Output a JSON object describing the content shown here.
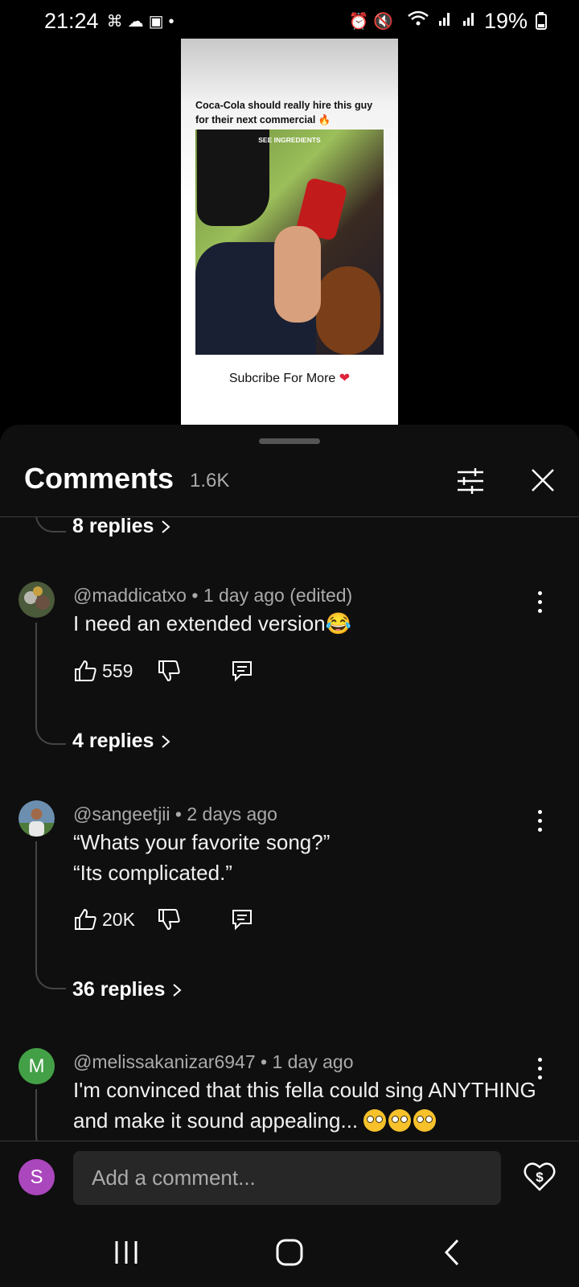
{
  "status_bar": {
    "time": "21:24",
    "left_icons": [
      "game-icon",
      "cloud-icon",
      "gallery-icon",
      "dot-icon"
    ],
    "right_icons": [
      "alarm-icon",
      "mute-icon",
      "wifi-icon",
      "signal-icon",
      "signal-icon"
    ],
    "battery": "19%"
  },
  "video": {
    "caption": "Coca-Cola should really hire this guy for their next commercial 🔥",
    "overlay_label": "SEE INGREDIENTS",
    "subscribe_text": "Subcribe For More",
    "heart": "❤"
  },
  "comments_panel": {
    "title": "Comments",
    "count": "1.6K",
    "filter_icon": "sliders-icon",
    "close_icon": "close-icon"
  },
  "comments": [
    {
      "replies_label": "8 replies"
    },
    {
      "author": "@maddicatxo",
      "time": "1 day ago (edited)",
      "separator": "•",
      "lines": [
        "I need an extended version😂"
      ],
      "likes": "559",
      "replies_label": "4 replies"
    },
    {
      "author": "@sangeetjii",
      "time": "2 days ago",
      "separator": "•",
      "lines": [
        "“Whats your favorite song?”",
        "“Its complicated.”"
      ],
      "likes": "20K",
      "replies_label": "36 replies"
    },
    {
      "author": "@melissakanizar6947",
      "time": "1 day ago",
      "separator": "•",
      "avatar_letter": "M",
      "avatar_color": "#43a047",
      "lines": [
        "I'm convinced that this fella could sing ANYTHING",
        "and make it sound appealing..."
      ]
    }
  ],
  "composer": {
    "avatar_letter": "S",
    "avatar_color": "#ab47bc",
    "placeholder": "Add a comment...",
    "thanks_icon": "heart-dollar-icon"
  },
  "nav_bar": {
    "icons": [
      "recent-apps-icon",
      "home-icon",
      "back-icon"
    ]
  }
}
